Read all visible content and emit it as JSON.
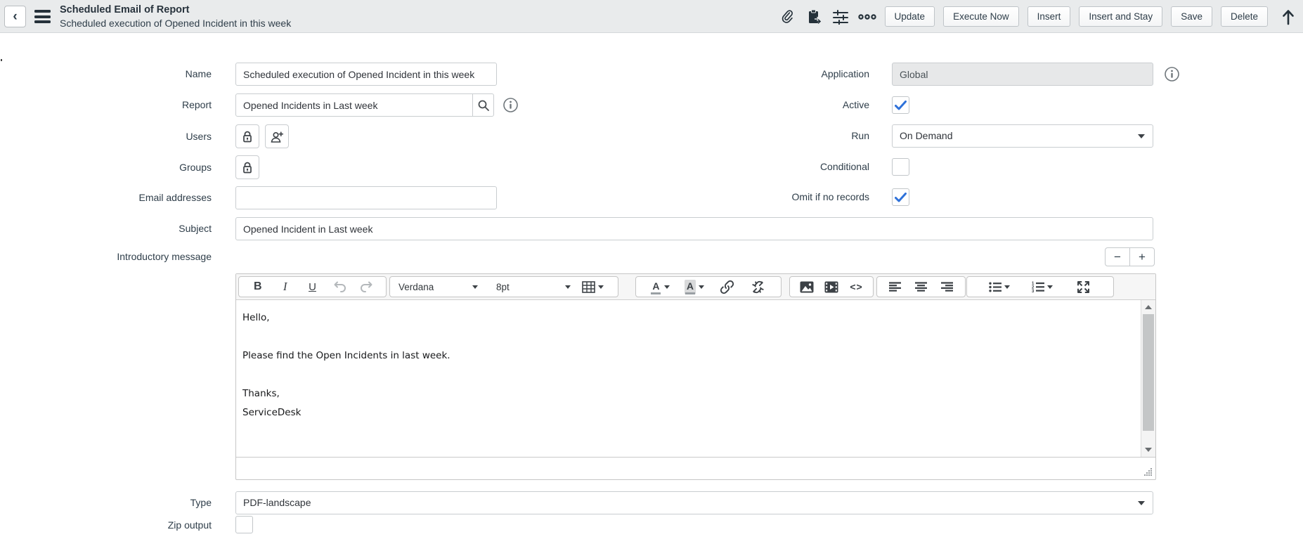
{
  "header": {
    "title": "Scheduled Email of Report",
    "subtitle": "Scheduled execution of Opened Incident in this week",
    "buttons": {
      "update": "Update",
      "execute_now": "Execute Now",
      "insert": "Insert",
      "insert_and_stay": "Insert and Stay",
      "save": "Save",
      "delete": "Delete"
    }
  },
  "form": {
    "left": {
      "name": {
        "label": "Name",
        "value": "Scheduled execution of Opened Incident in this week"
      },
      "report": {
        "label": "Report",
        "value": "Opened Incidents in Last week"
      },
      "users": {
        "label": "Users"
      },
      "groups": {
        "label": "Groups"
      },
      "email_addresses": {
        "label": "Email addresses",
        "value": ""
      },
      "subject": {
        "label": "Subject",
        "value": "Opened Incident in Last week"
      },
      "introductory_message": {
        "label": "Introductory message"
      },
      "type": {
        "label": "Type",
        "value": "PDF-landscape"
      },
      "zip_output": {
        "label": "Zip output",
        "checked": false
      }
    },
    "right": {
      "application": {
        "label": "Application",
        "value": "Global",
        "readonly": true
      },
      "active": {
        "label": "Active",
        "checked": true
      },
      "run": {
        "label": "Run",
        "value": "On Demand"
      },
      "conditional": {
        "label": "Conditional",
        "checked": false
      },
      "omit_if_no_records": {
        "label": "Omit if no records",
        "checked": true
      }
    }
  },
  "editor": {
    "toolbar": {
      "bold": "B",
      "italic": "I",
      "underline": "U",
      "font_name": "Verdana",
      "font_size": "8pt",
      "code": "<>"
    },
    "resize_controls": {
      "minus": "−",
      "plus": "+"
    },
    "lines": [
      "Hello,",
      "",
      "Please find the Open Incidents in last week.",
      "",
      "Thanks,",
      "ServiceDesk"
    ]
  },
  "icons": {
    "back": "‹",
    "more_options": "ooo"
  },
  "colors": {
    "header_bg": "#e9ebec",
    "ink": "#2e3d49",
    "accent_blue": "#2e71d9",
    "border": "#c9cdd0",
    "readonly_bg": "#e7e8e9"
  }
}
